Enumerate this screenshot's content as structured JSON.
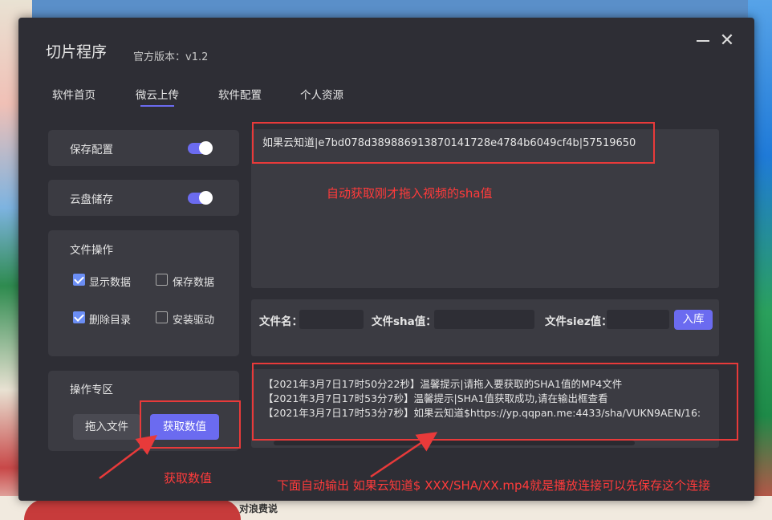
{
  "window": {
    "title": "切片程序",
    "version": "官方版本：v1.2",
    "minimize_icon": "minimize-icon",
    "close_icon": "close-icon",
    "close_glyph": "✕"
  },
  "tabs": [
    {
      "label": "软件首页",
      "active": false
    },
    {
      "label": "微云上传",
      "active": true
    },
    {
      "label": "软件配置",
      "active": false
    },
    {
      "label": "个人资源",
      "active": false
    }
  ],
  "left": {
    "save_config": {
      "label": "保存配置",
      "on": true
    },
    "cloud_storage": {
      "label": "云盘储存",
      "on": true
    },
    "file_ops": {
      "title": "文件操作",
      "options": [
        {
          "label": "显示数据",
          "checked": true
        },
        {
          "label": "保存数据",
          "checked": false
        },
        {
          "label": "删除目录",
          "checked": true
        },
        {
          "label": "安装驱动",
          "checked": false
        }
      ]
    },
    "op_zone": {
      "title": "操作专区",
      "drag_button": "拖入文件",
      "get_button": "获取数值"
    }
  },
  "output": {
    "sha_line": "如果云知道|e7bd078d389886913870141728e4784b6049cf4b|57519650"
  },
  "form": {
    "filename_label": "文件名：",
    "filename_value": "",
    "sha_label": "文件sha值：",
    "sha_value": "",
    "size_label": "文件siez值：",
    "size_value": "",
    "submit_button": "入库"
  },
  "log": {
    "lines": [
      "【2021年3月7日17时50分22秒】温馨提示|请拖入要获取的SHA1值的MP4文件",
      "【2021年3月7日17时53分7秒】温馨提示|SHA1值获取成功,请在输出框查看",
      "【2021年3月7日17时53分7秒】如果云知道$https://yp.qqpan.me:4433/sha/VUKN9AEN/16:"
    ]
  },
  "annotations": {
    "sha_note": "自动获取刚才拖入视频的sha值",
    "get_note": "获取数值",
    "output_note": "下面自动输出 如果云知道$ XXX/SHA/XX.mp4就是播放连接可以先保存这个连接"
  },
  "background": {
    "bottom_text": "对浪费说"
  },
  "colors": {
    "accent": "#6b6bf0",
    "window_bg": "#2e2e35",
    "panel_bg": "#3b3b42",
    "annotation_red": "#e83a3a"
  }
}
